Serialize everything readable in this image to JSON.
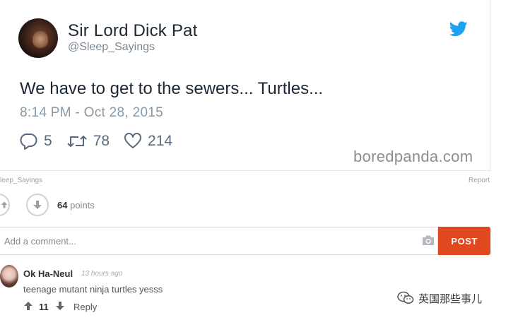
{
  "tweet": {
    "display_name": "Sir Lord Dick Pat",
    "handle": "@Sleep_Sayings",
    "text": "We have to get to the sewers... Turtles...",
    "timestamp": "8:14 PM - Oct 28, 2015",
    "replies": "5",
    "retweets": "78",
    "likes": "214",
    "watermark": "boredpanda.com",
    "icons": [
      "twitter-bird-icon",
      "reply-icon",
      "retweet-icon",
      "heart-icon"
    ],
    "brand_color": "#1da1f2"
  },
  "post_meta": {
    "source": "leep_Sayings",
    "report_label": "Report"
  },
  "votes": {
    "points_value": "64",
    "points_label": "points"
  },
  "comment_form": {
    "placeholder": "Add a comment...",
    "post_label": "POST",
    "post_color": "#e0481f"
  },
  "comments": [
    {
      "author": "Ok Ha-Neul",
      "time": "13 hours ago",
      "text": "teenage mutant ninja turtles yesss",
      "votes": "11",
      "reply_label": "Reply"
    }
  ],
  "wechat_watermark": "英国那些事儿"
}
